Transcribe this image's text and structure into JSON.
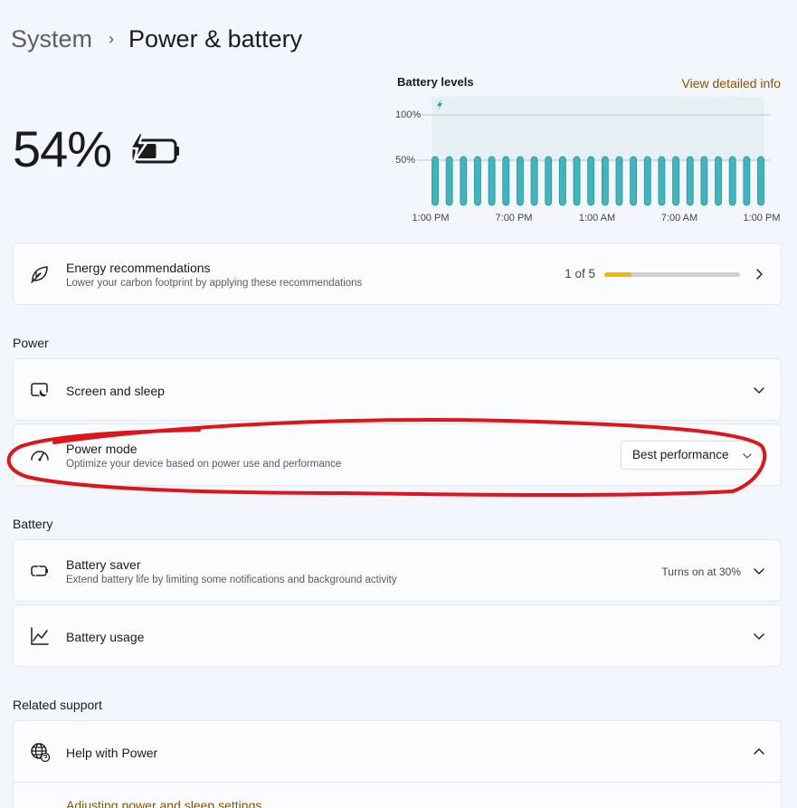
{
  "breadcrumb": {
    "parent": "System",
    "separator": "›",
    "current": "Power & battery"
  },
  "battery": {
    "percent_text": "54%",
    "level": 0.54,
    "charging": true
  },
  "battery_chart": {
    "title": "Battery levels",
    "link": "View detailed info",
    "y_ticks": [
      "100%",
      "50%"
    ],
    "x_ticks": [
      "1:00 PM",
      "7:00 PM",
      "1:00 AM",
      "7:00 AM",
      "1:00 PM"
    ],
    "bar_color": "#3fb6be",
    "bar_count": 24
  },
  "chart_data": {
    "type": "bar",
    "title": "Battery levels",
    "xlabel": "",
    "ylabel": "",
    "ylim": [
      0,
      100
    ],
    "x_ticks": [
      "1:00 PM",
      "7:00 PM",
      "1:00 AM",
      "7:00 AM",
      "1:00 PM"
    ],
    "values": [
      54,
      54,
      54,
      54,
      54,
      54,
      54,
      54,
      54,
      54,
      54,
      54,
      54,
      54,
      54,
      54,
      54,
      54,
      54,
      54,
      54,
      54,
      54,
      54
    ]
  },
  "energy": {
    "title": "Energy recommendations",
    "subtitle": "Lower your carbon footprint by applying these recommendations",
    "progress_text": "1 of 5",
    "progress_fraction": 0.2
  },
  "power": {
    "section_label": "Power",
    "screen_sleep": {
      "title": "Screen and sleep"
    },
    "power_mode": {
      "title": "Power mode",
      "subtitle": "Optimize your device based on power use and performance",
      "selected": "Best performance"
    }
  },
  "battery_section": {
    "section_label": "Battery",
    "saver": {
      "title": "Battery saver",
      "subtitle": "Extend battery life by limiting some notifications and background activity",
      "status": "Turns on at 30%"
    },
    "usage": {
      "title": "Battery usage"
    }
  },
  "related": {
    "section_label": "Related support",
    "help": {
      "title": "Help with Power"
    },
    "link": "Adjusting power and sleep settings"
  },
  "colors": {
    "accent_link": "#8a5300",
    "progress_fill": "#f5b800",
    "annotation": "#e0141b"
  }
}
